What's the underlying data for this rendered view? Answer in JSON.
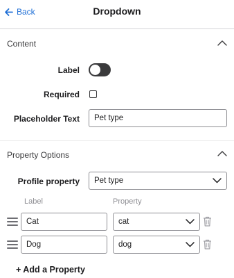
{
  "header": {
    "back_label": "Back",
    "title": "Dropdown"
  },
  "content_section": {
    "title": "Content",
    "label_label": "Label",
    "label_toggle_on": false,
    "required_label": "Required",
    "required_checked": false,
    "placeholder_label": "Placeholder Text",
    "placeholder_value": "Pet type"
  },
  "property_options": {
    "title": "Property Options",
    "profile_property_label": "Profile property",
    "profile_property_value": "Pet type",
    "columns": {
      "label": "Label",
      "property": "Property"
    },
    "rows": [
      {
        "label": "Cat",
        "property": "cat"
      },
      {
        "label": "Dog",
        "property": "dog"
      }
    ],
    "add_label": "+ Add a Property"
  }
}
